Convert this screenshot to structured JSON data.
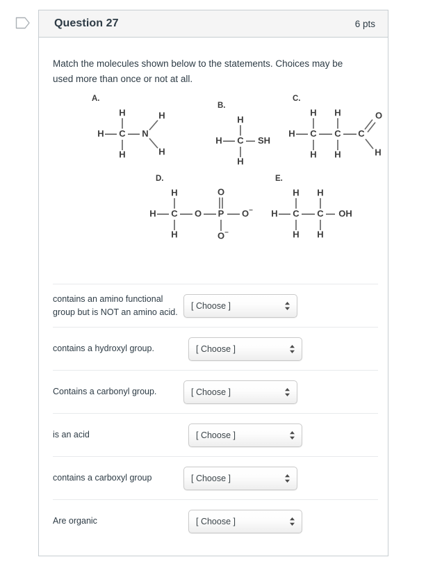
{
  "flag": {
    "icon": "flag-outline-icon"
  },
  "question": {
    "title": "Question 27",
    "points": "6 pts",
    "prompt": "Match the molecules shown below to the statements. Choices may be used more than once or not at all."
  },
  "molecules": [
    {
      "label": "A.",
      "name": "methylamine",
      "atoms": [
        "H",
        "C",
        "N",
        "H",
        "H",
        "H"
      ],
      "description": "H-C with H above and H below, bonded to N with two H substituents"
    },
    {
      "label": "B.",
      "name": "methanethiol",
      "atoms": [
        "H",
        "C",
        "SH",
        "H",
        "H"
      ],
      "description": "H-C with H above and H below, bonded to SH"
    },
    {
      "label": "C.",
      "name": "propanal",
      "atoms": [
        "H",
        "C",
        "C",
        "C",
        "O",
        "H",
        "H",
        "H",
        "H",
        "H"
      ],
      "description": "H-C-C-C chain with H above and below each carbon, terminal carbon double bonded to O and single bonded to H"
    },
    {
      "label": "D.",
      "name": "methyl phosphate",
      "atoms": [
        "H",
        "C",
        "O",
        "P",
        "O",
        "O⁻",
        "O⁻",
        "H",
        "H"
      ],
      "description": "H-C-O-P with O double bond above P, O minus to right and O minus below"
    },
    {
      "label": "E.",
      "name": "ethanol",
      "atoms": [
        "H",
        "C",
        "C",
        "OH",
        "H",
        "H",
        "H",
        "H"
      ],
      "description": "H-C-C-OH with H above and below each carbon"
    }
  ],
  "answer_rows": [
    {
      "statement": "contains an amino functional group but is NOT an amino acid.",
      "selected": "[ Choose ]"
    },
    {
      "statement": "contains a hydroxyl group.",
      "selected": "[ Choose ]"
    },
    {
      "statement": "Contains a carbonyl group.",
      "selected": "[ Choose ]"
    },
    {
      "statement": "is an acid",
      "selected": "[ Choose ]"
    },
    {
      "statement": "contains a carboxyl group",
      "selected": "[ Choose ]"
    },
    {
      "statement": "Are organic",
      "selected": "[ Choose ]"
    }
  ],
  "colors": {
    "card_border": "#c7cdd1",
    "header_bg": "#f5f5f5",
    "text": "#2d3b45",
    "divider": "#e8eaec",
    "molecule_stroke": "#585858"
  }
}
